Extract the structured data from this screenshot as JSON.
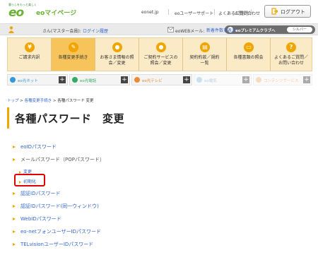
{
  "header": {
    "logo_tagline": "暮らしをもっと楽しく",
    "logo_mark": "eo",
    "site_title": "eoマイページ",
    "links": [
      "eonet.jp",
      "eoユーザーサポート",
      "よくあるご質問",
      "お問い合わせ"
    ],
    "logout_label": "ログアウト"
  },
  "member_bar": {
    "greeting": "さん(マスター会員):",
    "login_history": "ログイン履歴",
    "webmail_prefix": "eoWEBメール:",
    "webmail_link": "新着件数を表示",
    "premium_label": "eoプレミアムクラブへ",
    "premium_badge": "シルバー"
  },
  "main_nav": [
    {
      "icon": "¥",
      "label": "ご請求内訳"
    },
    {
      "icon": "✎",
      "label": "各種変更手続き"
    },
    {
      "icon": "●",
      "label": "お客さま情報の照会／変更"
    },
    {
      "icon": "●",
      "label": "ご契約サービスの照会／変更"
    },
    {
      "icon": "▤",
      "label": "契約約款／規約一覧"
    },
    {
      "icon": "▭",
      "label": "各種書類の照会"
    },
    {
      "icon": "?",
      "label": "よくあるご質問／お問い合わせ"
    }
  ],
  "services": [
    {
      "label": "eo光ネット",
      "color": "#3399dd"
    },
    {
      "label": "eo光電話",
      "color": "#33aa66"
    },
    {
      "label": "eo光テレビ",
      "color": "#ee8833"
    },
    {
      "label": "eo電気",
      "color": "#88bbdd"
    },
    {
      "label": "コンテンツサービス",
      "color": "#f0b070"
    }
  ],
  "breadcrumb": {
    "items": [
      "トップ",
      "各種変更手続き",
      "各種パスワード 変更"
    ],
    "sep": ">"
  },
  "page_title": "各種パスワード　変更",
  "list": {
    "eoid": "eoIDパスワード",
    "mail": "メールパスワード（POPパスワード）",
    "mail_change": "変更",
    "mail_init": "初期化",
    "auth_id": "認証IDパスワード",
    "auth_id_same": "認証IDパスワード(同一ウィンドウ)",
    "webid": "WebIDパスワード",
    "eonet_phone": "eo-netフォンユーザーIDパスワード",
    "telvision": "TELvisionユーザーIDパスワード"
  },
  "colors": {
    "accent": "#f0a500",
    "brand_green": "#6ab233",
    "link": "#3366cc",
    "highlight": "#e00000"
  }
}
